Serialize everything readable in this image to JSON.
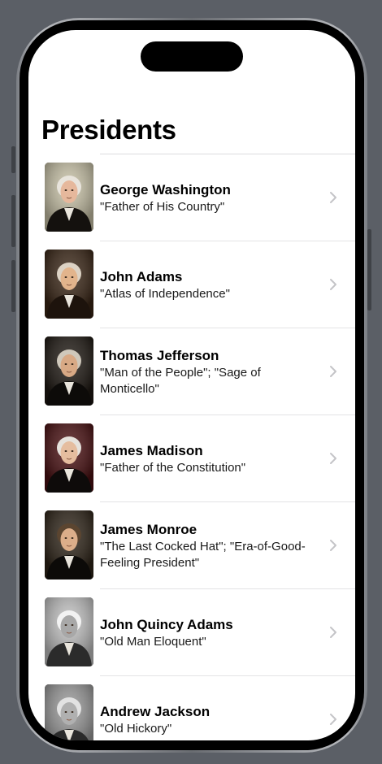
{
  "nav": {
    "title": "Presidents"
  },
  "presidents": [
    {
      "name": "George Washington",
      "nickname": "\"Father of His Country\"",
      "portrait": {
        "bg": "#c9c3a8",
        "hair": "#e8e4dc",
        "face": "#e6b89c",
        "coat": "#14110e"
      }
    },
    {
      "name": "John Adams",
      "nickname": "\"Atlas of Independence\"",
      "portrait": {
        "bg": "#3a2616",
        "hair": "#dcd2c4",
        "face": "#e2b48c",
        "coat": "#1d130c"
      }
    },
    {
      "name": "Thomas Jefferson",
      "nickname": "\"Man of the People\"; \"Sage of Monticello\"",
      "portrait": {
        "bg": "#1e1812",
        "hair": "#cfc8bb",
        "face": "#d8a985",
        "coat": "#0d0b09"
      }
    },
    {
      "name": "James Madison",
      "nickname": "\"Father of the Constitution\"",
      "portrait": {
        "bg": "#4a1012",
        "hair": "#e6e2dc",
        "face": "#e5bd9f",
        "coat": "#0e0b0a"
      }
    },
    {
      "name": "James Monroe",
      "nickname": "\"The Last Cocked Hat\"; \"Era-of-Good-Feeling President\"",
      "portrait": {
        "bg": "#2e2418",
        "hair": "#5b4530",
        "face": "#dcae8a",
        "coat": "#0c0a08"
      }
    },
    {
      "name": "John Quincy Adams",
      "nickname": "\"Old Man Eloquent\"",
      "portrait": {
        "bg": "#c2c2c2",
        "hair": "#f2f2f2",
        "face": "#a8a8a8",
        "coat": "#2b2b2b"
      }
    },
    {
      "name": "Andrew Jackson",
      "nickname": "\"Old Hickory\"",
      "portrait": {
        "bg": "#9a9a9a",
        "hair": "#e2e2e2",
        "face": "#b0b0b0",
        "coat": "#2a2a2a"
      }
    }
  ]
}
